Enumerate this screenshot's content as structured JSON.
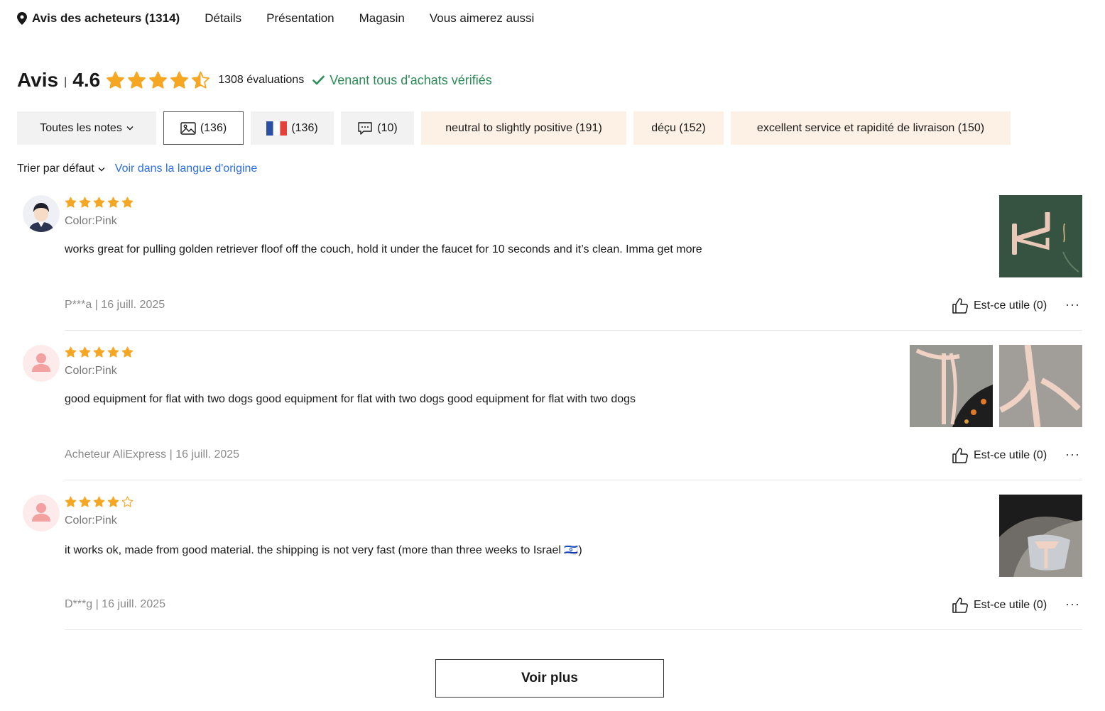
{
  "nav": {
    "items": [
      "Avis des acheteurs (1314)",
      "Détails",
      "Présentation",
      "Magasin",
      "Vous aimerez aussi"
    ]
  },
  "rating": {
    "title": "Avis",
    "separator": "|",
    "score": "4.6",
    "stars": 4.5,
    "count_label": "1308 évaluations",
    "verified_label": "Venant tous d'achats vérifiés"
  },
  "filters": {
    "all_notes": "Toutes les notes",
    "photos": "(136)",
    "france": "(136)",
    "comments": "(10)",
    "tags": [
      "neutral to slightly positive (191)",
      "déçu (152)",
      "excellent service et rapidité de livraison (150)"
    ]
  },
  "sort": {
    "label": "Trier par défaut",
    "origin_link": "Voir dans la langue d'origine"
  },
  "reviews": [
    {
      "rating": 5,
      "color": "Color:Pink",
      "text": "works great for pulling golden retriever floof off the couch, hold it under the faucet for 10 seconds and it’s clean. Imma get more",
      "meta": "P***a | 16 juill. 2025",
      "helpful": "Est-ce utile (0)",
      "more": "···"
    },
    {
      "rating": 5,
      "color": "Color:Pink",
      "text": "good equipment for flat with two dogs good equipment for flat with two dogs good equipment for flat with two dogs",
      "meta": "Acheteur AliExpress | 16 juill. 2025",
      "helpful": "Est-ce utile (0)",
      "more": "···"
    },
    {
      "rating": 4,
      "color": "Color:Pink",
      "text": "it works ok, made from good material. the shipping is not very fast (more than three weeks to Israel 🇮🇱)",
      "meta": "D***g | 16 juill. 2025",
      "helpful": "Est-ce utile (0)",
      "more": "···"
    }
  ],
  "voir_plus": "Voir plus",
  "colors": {
    "star": "#f5a623",
    "verified": "#2e8b57",
    "link": "#2d6ee0",
    "tag_bg": "#fdf1e5",
    "chip_bg": "#f2f2f2"
  }
}
